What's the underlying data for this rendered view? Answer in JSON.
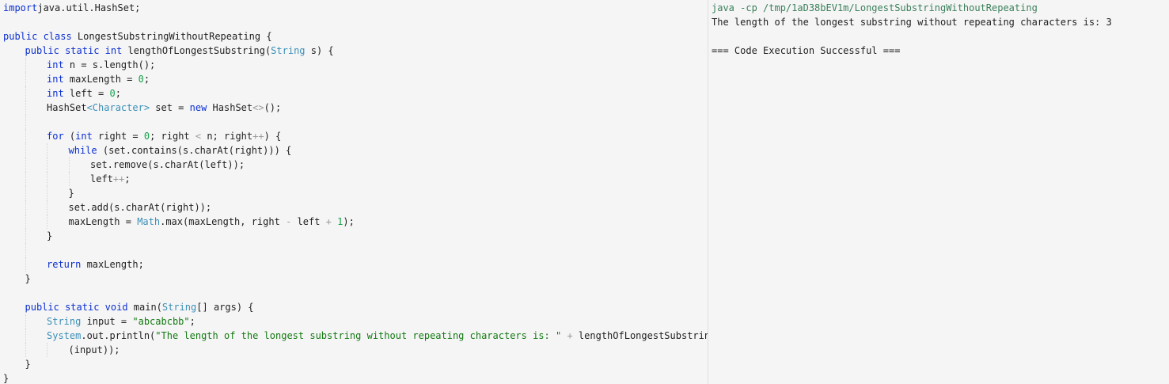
{
  "editor": {
    "lines": [
      {
        "indent": 0,
        "parts": [
          [
            "kw",
            "import"
          ],
          [
            "",
            "java.util.HashSet;"
          ]
        ]
      },
      {
        "indent": 0,
        "parts": []
      },
      {
        "indent": 0,
        "parts": [
          [
            "kw",
            "public class "
          ],
          [
            "",
            "LongestSubstringWithoutRepeating {"
          ]
        ]
      },
      {
        "indent": 1,
        "parts": [
          [
            "kw",
            "public static int "
          ],
          [
            "",
            "lengthOfLongestSubstring("
          ],
          [
            "ty",
            "String"
          ],
          [
            "",
            " s) {"
          ]
        ]
      },
      {
        "indent": 2,
        "parts": [
          [
            "kw",
            "int "
          ],
          [
            "",
            "n = s.length();"
          ]
        ]
      },
      {
        "indent": 2,
        "parts": [
          [
            "kw",
            "int "
          ],
          [
            "",
            "maxLength = "
          ],
          [
            "nu",
            "0"
          ],
          [
            "",
            ";"
          ]
        ]
      },
      {
        "indent": 2,
        "parts": [
          [
            "kw",
            "int "
          ],
          [
            "",
            "left = "
          ],
          [
            "nu",
            "0"
          ],
          [
            "",
            ";"
          ]
        ]
      },
      {
        "indent": 2,
        "parts": [
          [
            "",
            "HashSet"
          ],
          [
            "ty",
            "<Character>"
          ],
          [
            "",
            " set = "
          ],
          [
            "kw",
            "new "
          ],
          [
            "",
            "HashSet"
          ],
          [
            "op",
            "<>"
          ],
          [
            "",
            "();"
          ]
        ]
      },
      {
        "indent": 2,
        "parts": []
      },
      {
        "indent": 2,
        "parts": [
          [
            "kw",
            "for "
          ],
          [
            "",
            "("
          ],
          [
            "kw",
            "int "
          ],
          [
            "",
            "right = "
          ],
          [
            "nu",
            "0"
          ],
          [
            "",
            "; right "
          ],
          [
            "op",
            "<"
          ],
          [
            "",
            " n; right"
          ],
          [
            "op",
            "++"
          ],
          [
            "",
            ") {"
          ]
        ]
      },
      {
        "indent": 3,
        "parts": [
          [
            "kw",
            "while "
          ],
          [
            "",
            "(set.contains(s.charAt(right))) {"
          ]
        ]
      },
      {
        "indent": 4,
        "parts": [
          [
            "",
            "set.remove(s.charAt(left));"
          ]
        ]
      },
      {
        "indent": 4,
        "parts": [
          [
            "",
            "left"
          ],
          [
            "op",
            "++"
          ],
          [
            "",
            ";"
          ]
        ]
      },
      {
        "indent": 3,
        "parts": [
          [
            "",
            "}"
          ]
        ]
      },
      {
        "indent": 3,
        "parts": [
          [
            "",
            "set.add(s.charAt(right));"
          ]
        ]
      },
      {
        "indent": 3,
        "parts": [
          [
            "",
            "maxLength = "
          ],
          [
            "cl",
            "Math"
          ],
          [
            "",
            ".max(maxLength, right "
          ],
          [
            "op",
            "-"
          ],
          [
            "",
            " left "
          ],
          [
            "op",
            "+"
          ],
          [
            "",
            " "
          ],
          [
            "nu",
            "1"
          ],
          [
            "",
            ");"
          ]
        ]
      },
      {
        "indent": 2,
        "parts": [
          [
            "",
            "}"
          ]
        ]
      },
      {
        "indent": 2,
        "parts": []
      },
      {
        "indent": 2,
        "parts": [
          [
            "kw",
            "return "
          ],
          [
            "",
            "maxLength;"
          ]
        ]
      },
      {
        "indent": 1,
        "parts": [
          [
            "",
            "}"
          ]
        ]
      },
      {
        "indent": 1,
        "parts": []
      },
      {
        "indent": 1,
        "parts": [
          [
            "kw",
            "public static void "
          ],
          [
            "",
            "main("
          ],
          [
            "ty",
            "String"
          ],
          [
            "",
            "[] args) {"
          ]
        ]
      },
      {
        "indent": 2,
        "parts": [
          [
            "ty",
            "String "
          ],
          [
            "",
            "input = "
          ],
          [
            "st",
            "\"abcabcbb\""
          ],
          [
            "",
            ";"
          ]
        ]
      },
      {
        "indent": 2,
        "parts": [
          [
            "cl",
            "System"
          ],
          [
            "",
            ".out.println("
          ],
          [
            "st",
            "\"The length of the longest substring without repeating characters is: \""
          ],
          [
            "",
            " "
          ],
          [
            "op",
            "+"
          ],
          [
            "",
            " lengthOfLongestSubstring"
          ]
        ]
      },
      {
        "indent": 3,
        "parts": [
          [
            "",
            "(input));"
          ]
        ]
      },
      {
        "indent": 1,
        "parts": [
          [
            "",
            "}"
          ]
        ]
      },
      {
        "indent": 0,
        "parts": [
          [
            "",
            "}"
          ]
        ]
      }
    ]
  },
  "output": {
    "command": "java -cp /tmp/1aD38bEV1m/LongestSubstringWithoutRepeating",
    "result": "The length of the longest substring without repeating characters is: 3",
    "blank": "",
    "status": "=== Code Execution Successful ==="
  }
}
